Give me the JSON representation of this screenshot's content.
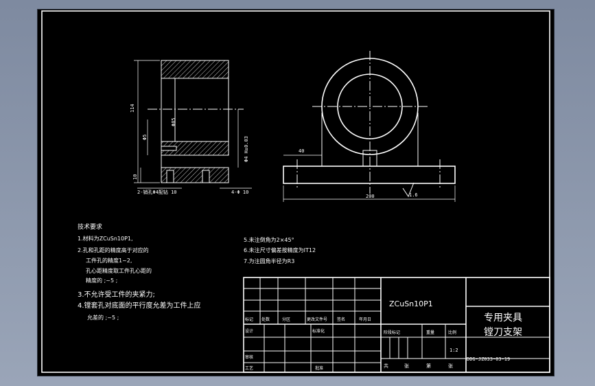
{
  "drawing": {
    "tech_requirements": {
      "title": "技术要求",
      "items": [
        "1.材料为ZCuSn10P1,",
        "2.孔和孔距的精度高于对应的",
        "工件孔的精度1~2,",
        "孔心距精度取工件孔心距的",
        "精度的 ;~5 ;",
        "3.不允许受工件的夹紧力;",
        "4.镗套孔对底面的平行度允差为工件上应",
        "允差的 ;~5 ;",
        "5.未注倒角为2×45°",
        "6.未注尺寸偏差按精度为IT12",
        "7.为注圆角半径为R3"
      ]
    },
    "dimensions": {
      "overall_height": "114",
      "inner_dim": "Φ85",
      "bore_dim": "Φ5",
      "outer_dim": "Φ4 H±0.03",
      "height_10": "10",
      "left_note": "2-销孔Φ4配钻 10",
      "right_note": "4-Φ 10",
      "dim_40": "40",
      "dim_200": "200",
      "roughness": "1.6"
    },
    "title_block": {
      "material": "ZCuSn10P1",
      "part_name_line1": "专用夹具",
      "part_name_line2": "镗刀支架",
      "drawing_number": "DDG-JZ033-03-19",
      "scale": "1:2",
      "labels": {
        "mark": "标记",
        "count": "处数",
        "zone": "分区",
        "change_doc": "更改文件号",
        "sign": "签名",
        "date": "年月日",
        "design": "设计",
        "standardize": "标准化",
        "stage_mark": "阶段标记",
        "weight": "重量",
        "ratio": "比例",
        "review": "审核",
        "process": "工艺",
        "approve": "批准",
        "total": "共",
        "sheet": "张",
        "page": "第",
        "page_sheet": "张"
      }
    }
  }
}
